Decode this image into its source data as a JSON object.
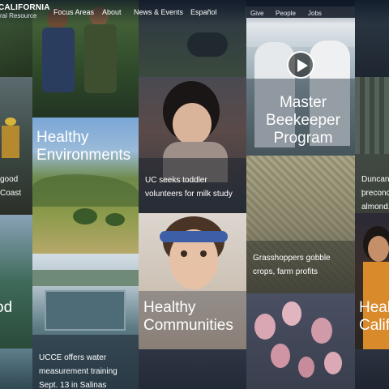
{
  "header": {
    "logo_line1": "CALIFORNIA",
    "logo_line2": "ral Resource",
    "nav": [
      "Focus Areas",
      "About",
      "News & Events",
      "Español"
    ],
    "utility": [
      "Give",
      "People",
      "Jobs"
    ]
  },
  "tiles": {
    "healthy_environments": "Healthy Environments",
    "toddler": "UC seeks toddler volunteers for milk study",
    "beekeeper": "Master Beekeeper Program",
    "duncan_line1": "Duncan '",
    "duncan_line2": "preconce",
    "duncan_line3": "almond, p",
    "good_coast_line1": "good",
    "good_coast_line2": "Coast",
    "grasshoppers": "Grasshoppers gobble crops, farm profits",
    "healthy_communities": "Healthy Communities",
    "healthy_calif": "Healt Califo",
    "food_partial": "od",
    "ucce": "UCCE offers water measurement training Sept. 13 in Salinas"
  },
  "colors": {
    "overlay_blue": "#3a78b8",
    "overlay_orange": "#d98a2b",
    "dark_bg": "#1c2430"
  },
  "icons": [
    "play-icon"
  ]
}
